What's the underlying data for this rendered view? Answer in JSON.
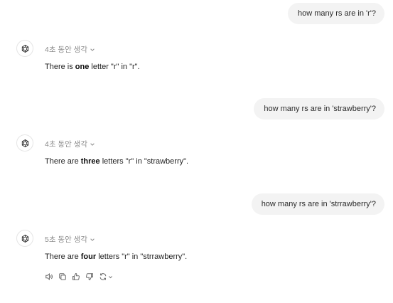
{
  "conversation": {
    "turns": [
      {
        "user": "how many rs are in 'r'?",
        "thinking": "4초 동안 생각",
        "answer": {
          "pre": "There is ",
          "bold": "one",
          "post": " letter \"r\" in \"r\"."
        }
      },
      {
        "user": "how many rs are in 'strawberry'?",
        "thinking": "4초 동안 생각",
        "answer": {
          "pre": "There are ",
          "bold": "three",
          "post": " letters \"r\" in \"strawberry\"."
        }
      },
      {
        "user": "how many rs are in 'strrawberry'?",
        "thinking": "5초 동안 생각",
        "answer": {
          "pre": "There are ",
          "bold": "four",
          "post": " letters \"r\" in \"strrawberry\"."
        }
      }
    ]
  },
  "action_icons": [
    "read-aloud-icon",
    "copy-icon",
    "thumbs-up-icon",
    "thumbs-down-icon",
    "regenerate-icon",
    "chevron-down-icon"
  ],
  "colors": {
    "user_bubble_bg": "#f3f3f3",
    "thinking_text": "#8c8c8c",
    "body_text": "#1f1f1f"
  }
}
